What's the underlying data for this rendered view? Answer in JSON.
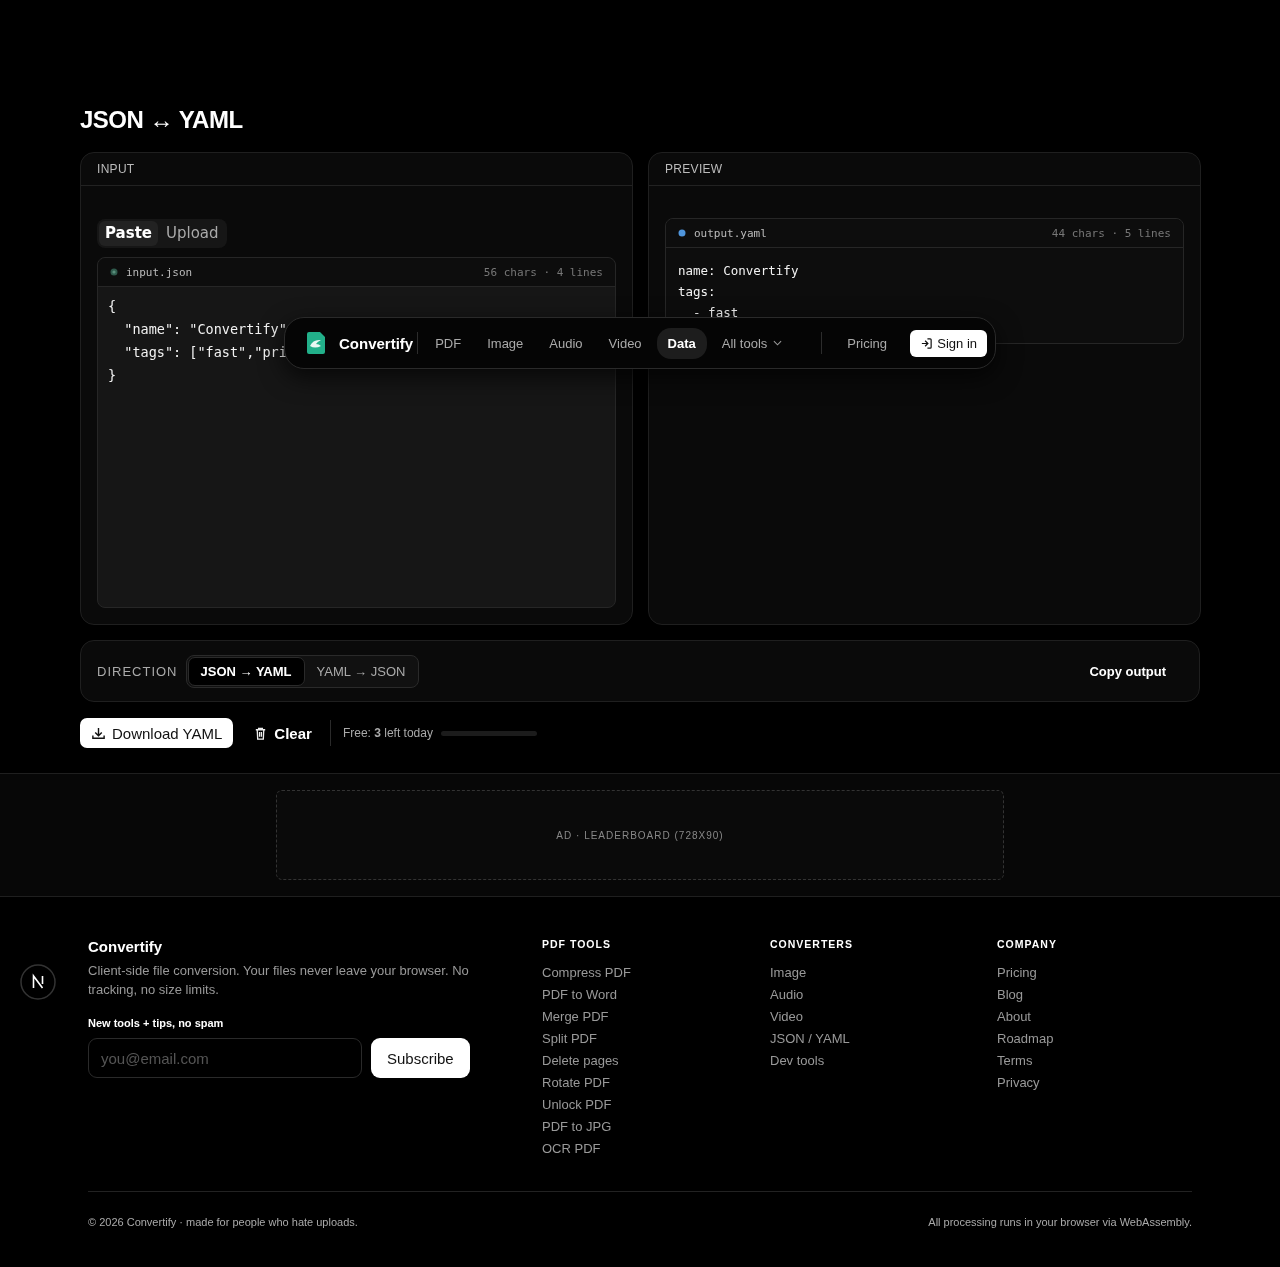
{
  "page_title": "JSON ↔ YAML",
  "input": {
    "header": "INPUT",
    "tabs": [
      {
        "label": "Paste",
        "selected": true
      },
      {
        "label": "Upload",
        "selected": false
      }
    ],
    "file": {
      "name": "input.json",
      "stats": "56 chars · 4 lines",
      "lines": [
        "{",
        "  \"name\": \"Convertify\"",
        "  \"tags\": [\"fast\",\"pri",
        "}"
      ]
    }
  },
  "preview": {
    "header": "PREVIEW",
    "file": {
      "name": "output.yaml",
      "stats": "44 chars · 5 lines",
      "lines": [
        "name: Convertify",
        "tags:",
        "  - fast"
      ]
    }
  },
  "nav": {
    "brand": "Convertify",
    "items": [
      {
        "label": "PDF",
        "selected": false,
        "kind": "link"
      },
      {
        "label": "Image",
        "selected": false,
        "kind": "link"
      },
      {
        "label": "Audio",
        "selected": false,
        "kind": "link"
      },
      {
        "label": "Video",
        "selected": false,
        "kind": "link"
      },
      {
        "label": "Data",
        "selected": true,
        "kind": "link"
      },
      {
        "label": "All tools",
        "selected": false,
        "kind": "dropdown"
      }
    ],
    "pricing": "Pricing",
    "sign_in": "Sign in"
  },
  "direction": {
    "label": "DIRECTION",
    "options": [
      {
        "label": "JSON → YAML",
        "selected": true
      },
      {
        "label": "YAML → JSON",
        "selected": false
      }
    ],
    "copy": "Copy output"
  },
  "actions": {
    "download": "Download YAML",
    "clear": "Clear",
    "usage": "Free: **3** left today",
    "level": 0
  },
  "ad": "AD · LEADERBOARD (728X90)",
  "footer": {
    "brand": "Convertify",
    "description": "Client-side file conversion. Your files never leave your browser. No tracking, no size limits.",
    "newsletter_label": "New tools + tips, no spam",
    "email": {
      "placeholder": "you@email.com"
    },
    "subscribe": "Subscribe",
    "columns": [
      {
        "title": "PDF TOOLS",
        "links": [
          "Compress PDF",
          "PDF to Word",
          "Merge PDF",
          "Split PDF",
          "Delete pages",
          "Rotate PDF",
          "Unlock PDF",
          "PDF to JPG",
          "OCR PDF"
        ]
      },
      {
        "title": "CONVERTERS",
        "links": [
          "Image",
          "Audio",
          "Video",
          "JSON / YAML",
          "Dev tools"
        ]
      },
      {
        "title": "COMPANY",
        "links": [
          "Pricing",
          "Blog",
          "About",
          "Roadmap",
          "Terms",
          "Privacy"
        ]
      }
    ],
    "copyright": "© 2026 Convertify · made for people who hate uploads.",
    "note": "All processing runs in your browser via WebAssembly."
  }
}
